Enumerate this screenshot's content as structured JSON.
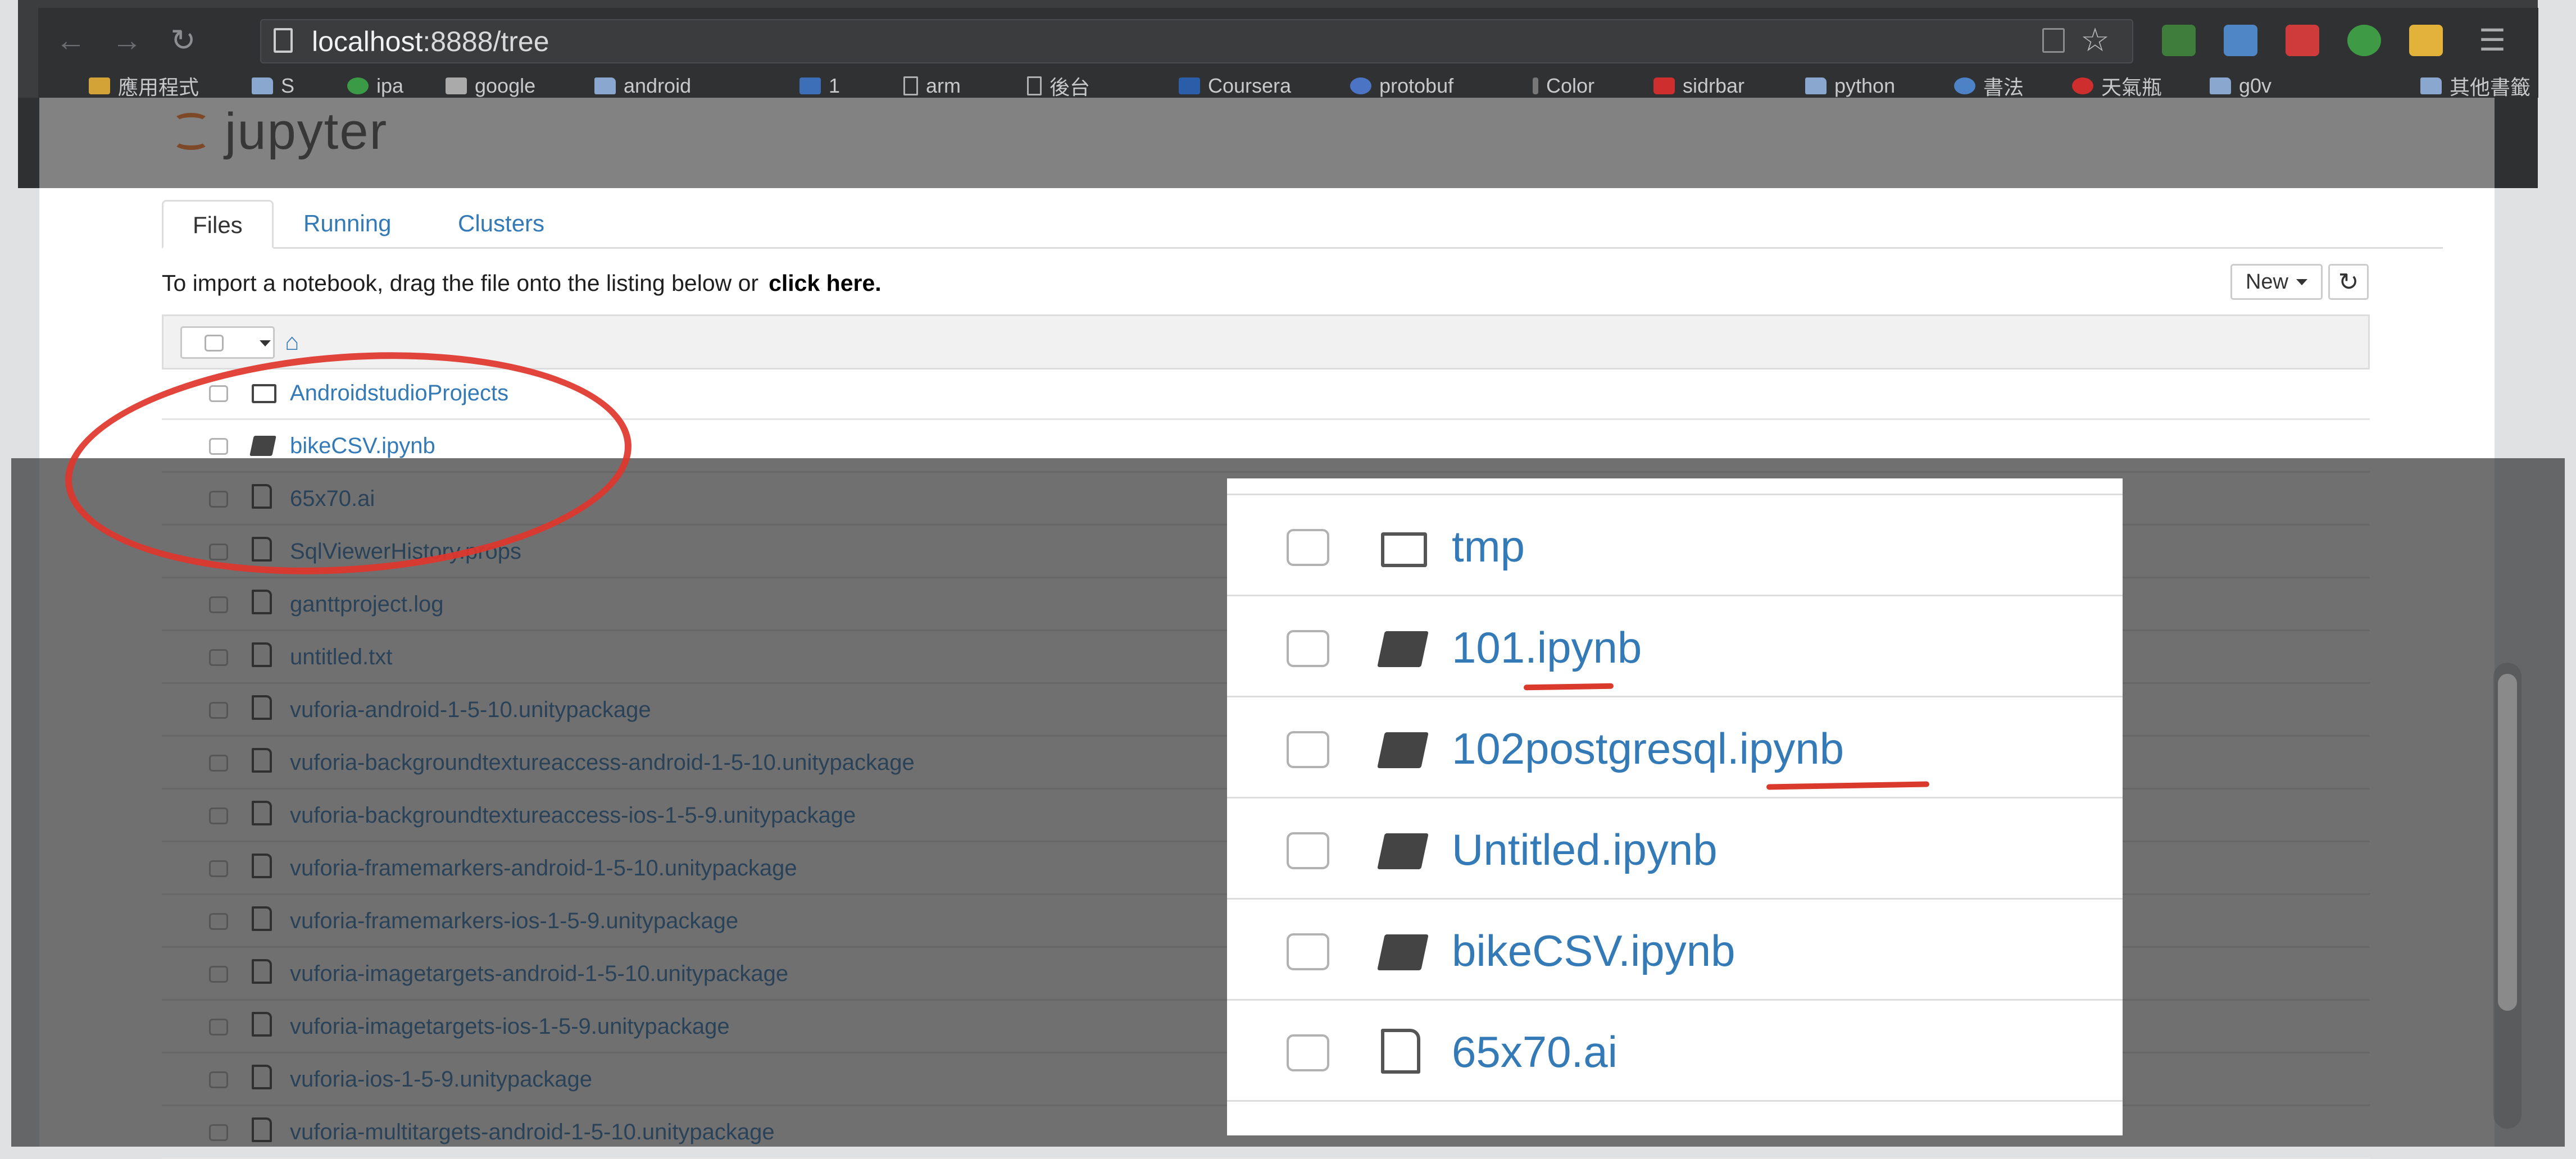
{
  "browser": {
    "url_host": "localhost",
    "url_rest": ":8888/tree",
    "bookmarks": [
      "應用程式",
      "S",
      "ipa",
      "google",
      "android",
      "1",
      "arm",
      "後台",
      "Coursera",
      "protobuf",
      "Color",
      "sidrbar",
      "python",
      "書法",
      "天氣瓶",
      "g0v",
      "其他書籤"
    ]
  },
  "jupyter": {
    "logo_text": "jupyter",
    "tabs": [
      "Files",
      "Running",
      "Clusters"
    ],
    "import_text": "To import a notebook, drag the file onto the listing below or",
    "import_link": "click here.",
    "new_label": "New",
    "refresh_icon": "refresh-icon",
    "home_icon": "home-icon",
    "files": [
      {
        "name": "AndroidstudioProjects",
        "type": "folder"
      },
      {
        "name": "bikeCSV.ipynb",
        "type": "notebook"
      },
      {
        "name": "65x70.ai",
        "type": "file"
      },
      {
        "name": "SqlViewerHistory.props",
        "type": "file"
      },
      {
        "name": "ganttproject.log",
        "type": "file"
      },
      {
        "name": "untitled.txt",
        "type": "file"
      },
      {
        "name": "vuforia-android-1-5-10.unitypackage",
        "type": "file"
      },
      {
        "name": "vuforia-backgroundtextureaccess-android-1-5-10.unitypackage",
        "type": "file"
      },
      {
        "name": "vuforia-backgroundtextureaccess-ios-1-5-9.unitypackage",
        "type": "file"
      },
      {
        "name": "vuforia-framemarkers-android-1-5-10.unitypackage",
        "type": "file"
      },
      {
        "name": "vuforia-framemarkers-ios-1-5-9.unitypackage",
        "type": "file"
      },
      {
        "name": "vuforia-imagetargets-android-1-5-10.unitypackage",
        "type": "file"
      },
      {
        "name": "vuforia-imagetargets-ios-1-5-9.unitypackage",
        "type": "file"
      },
      {
        "name": "vuforia-ios-1-5-9.unitypackage",
        "type": "file"
      },
      {
        "name": "vuforia-multitargets-android-1-5-10.unitypackage",
        "type": "file"
      }
    ]
  },
  "zoom": {
    "files": [
      {
        "name": "tmp",
        "type": "folder"
      },
      {
        "name": "101.ipynb",
        "type": "notebook"
      },
      {
        "name": "102postgresql.ipynb",
        "type": "notebook"
      },
      {
        "name": "Untitled.ipynb",
        "type": "notebook"
      },
      {
        "name": "bikeCSV.ipynb",
        "type": "notebook"
      },
      {
        "name": "65x70.ai",
        "type": "file"
      }
    ]
  },
  "colors": {
    "link": "#337ab7",
    "annotation_red": "#e0352b",
    "logo_orange": "#f37726"
  }
}
